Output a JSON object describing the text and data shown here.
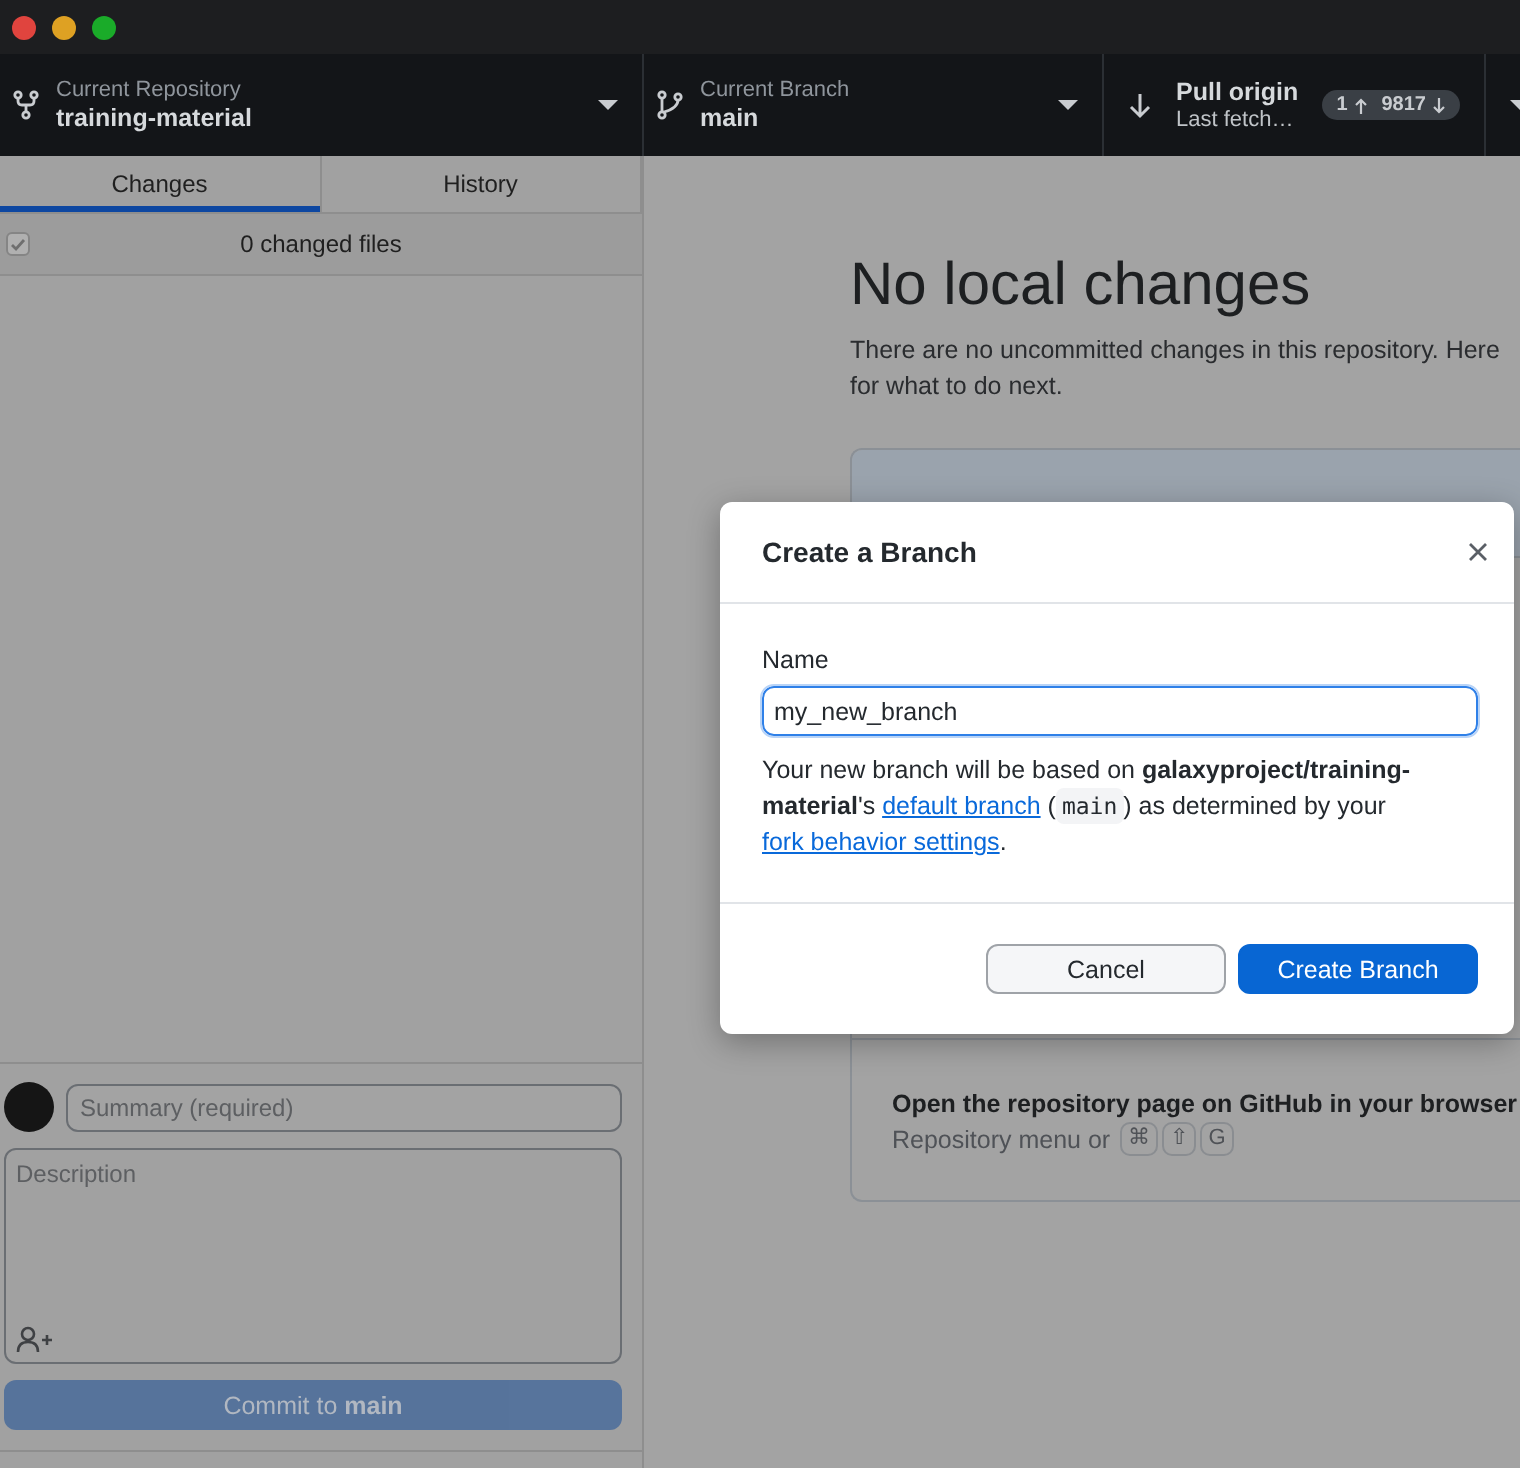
{
  "toolbar": {
    "repository": {
      "label": "Current Repository",
      "value": "training-material"
    },
    "branch": {
      "label": "Current Branch",
      "value": "main"
    },
    "pull": {
      "label": "Pull origin",
      "detail": "Last fetch…",
      "ahead": "1",
      "behind": "9817"
    }
  },
  "tabs": [
    {
      "label": "Changes",
      "selected": true
    },
    {
      "label": "History",
      "selected": false
    }
  ],
  "changes": {
    "checked": true,
    "count": "0 changed files"
  },
  "commit": {
    "summary_placeholder": "Summary (required)",
    "description_placeholder": "Description",
    "button": "Commit to **main**",
    "disabled": true
  },
  "main": {
    "title": "No local changes",
    "text": "There are no uncommitted changes in this repository. Here\nfor what to do next.",
    "cards": [
      {
        "title": "Open the repository page on GitHub in your browser",
        "hint": "Repository menu or",
        "keys": [
          "⌘",
          "⇧",
          "G"
        ]
      }
    ]
  },
  "dialog": {
    "title": "Create a Branch",
    "name_label": "Name",
    "value": "my_new_branch",
    "description": [
      {
        "kind": "text",
        "text": "Your new branch will be based on **galaxyproject/training-material**'s "
      },
      {
        "kind": "link",
        "text": "default branch"
      },
      {
        "kind": "text",
        "text": " ("
      },
      {
        "kind": "code",
        "text": "main"
      },
      {
        "kind": "text",
        "text": ") as determined by your "
      },
      {
        "kind": "link",
        "text": "fork behavior settings"
      },
      {
        "kind": "text",
        "text": "."
      }
    ],
    "buttons": [
      {
        "label": "Cancel",
        "kind": "secondary"
      },
      {
        "label": "Create Branch",
        "kind": "primary"
      }
    ]
  }
}
